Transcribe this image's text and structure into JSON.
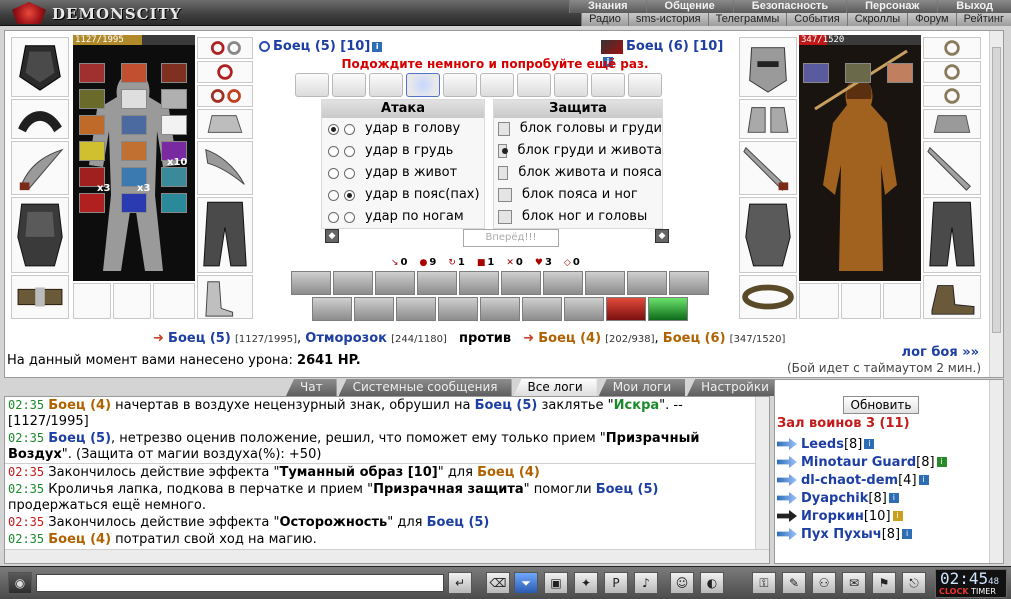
{
  "header": {
    "logo_text": "DEMONSCITY",
    "top_menu": [
      "Знания",
      "Общение",
      "Безопасность",
      "Персонаж",
      "Выход"
    ],
    "sub_menu": [
      "Радио",
      "sms-история",
      "Телеграммы",
      "События",
      "Скроллы",
      "Форум",
      "Рейтинг"
    ]
  },
  "left_fighter": {
    "name": "Боец",
    "level": "(5)",
    "level2": "[10]",
    "hp": "1127/1995",
    "hp_fraction": 0.565,
    "stack_1": "x10",
    "stack_2": "x3",
    "stack_3": "x3"
  },
  "right_fighter": {
    "name": "Боец",
    "level": "(6)",
    "level2": "[10]",
    "hp": "347/1520",
    "hp_fraction": 0.228
  },
  "battle": {
    "wait_message": "Подождите немного и попробуйте ещё раз.",
    "attack_title": "Атака",
    "defense_title": "Защита",
    "attacks": [
      "удар в голову",
      "удар в грудь",
      "удар в живот",
      "удар в пояс(пах)",
      "удар по ногам"
    ],
    "defenses": [
      "блок головы и груди",
      "блок груди и живота",
      "блок живота и пояса",
      "блок пояса и ног",
      "блок ног и головы"
    ],
    "forward_button": "Вперёд!!!",
    "stats": [
      "0",
      "9",
      "1",
      "1",
      "0",
      "3",
      "0"
    ],
    "versus": {
      "a1": "Боец (5)",
      "a1hp": "[1127/1995]",
      "a2": "Отморозок",
      "a2hp": "[244/1180]",
      "vs": "против",
      "b1": "Боец (4)",
      "b1hp": "[202/938]",
      "b2": "Боец (6)",
      "b2hp": "[347/1520]"
    },
    "damage_label": "На данный момент вами нанесено урона:",
    "damage_value": "2641 HP.",
    "log_link": "лог боя »»",
    "timer_note": "(Бой идет с таймаутом 2 мин.)"
  },
  "tabs": [
    "Чат",
    "Системные сообщения",
    "Все логи",
    "Мои логи",
    "Настройки"
  ],
  "chat": {
    "l1_time": "02:35",
    "l1_name": "Боец (4)",
    "l1_text": "начертав в воздухе нецензурный знак, обрушил на",
    "l1_target": "Боец (5)",
    "l1_text2": "заклятье \"",
    "l1_spell": "Искра",
    "l1_text3": "\". --",
    "l1_rest": "[1127/1995]",
    "l2_time": "02:35",
    "l2_name": "Боец (5)",
    "l2_text": ", нетрезво оценив положение, решил, что поможет ему только прием \"",
    "l2_skill": "Призрачный Воздух",
    "l2_text2": "\". (Защита от магии воздуха(%): +50)",
    "l3_time": "02:35",
    "l3_text": "Закончилось действие эффекта \"",
    "l3_effect": "Туманный образ [10]",
    "l3_text2": "\" для",
    "l3_name": "Боец (4)",
    "l4_time": "02:35",
    "l4_text": "Кроличья лапка, подкова в перчатке и прием \"",
    "l4_skill": "Призрачная защита",
    "l4_text2": "\" помогли",
    "l4_name": "Боец (5)",
    "l4_text3": "продержаться ещё немного.",
    "l5_time": "02:35",
    "l5_text": "Закончилось действие эффекта \"",
    "l5_effect": "Осторожность",
    "l5_text2": "\" для",
    "l5_name": "Боец (5)",
    "l6_time": "02:35",
    "l6_name": "Боец (4)",
    "l6_text": "потратил свой ход на магию."
  },
  "players": {
    "refresh": "Обновить",
    "hall": "Зал воинов 3 (11)",
    "list": [
      {
        "name": "Leeds",
        "lvl": "[8]"
      },
      {
        "name": "Minotaur Guard",
        "lvl": "[8]"
      },
      {
        "name": "dl-chaot-dem",
        "lvl": "[4]"
      },
      {
        "name": "Dyapchik",
        "lvl": "[8]"
      },
      {
        "name": "Игоркин",
        "lvl": "[10]"
      },
      {
        "name": "Пух Пухыч",
        "lvl": "[8]"
      }
    ]
  },
  "bottom": {
    "time": "02:45",
    "seconds": "48",
    "clock": "CLOCK",
    "timer": "TIMER"
  }
}
